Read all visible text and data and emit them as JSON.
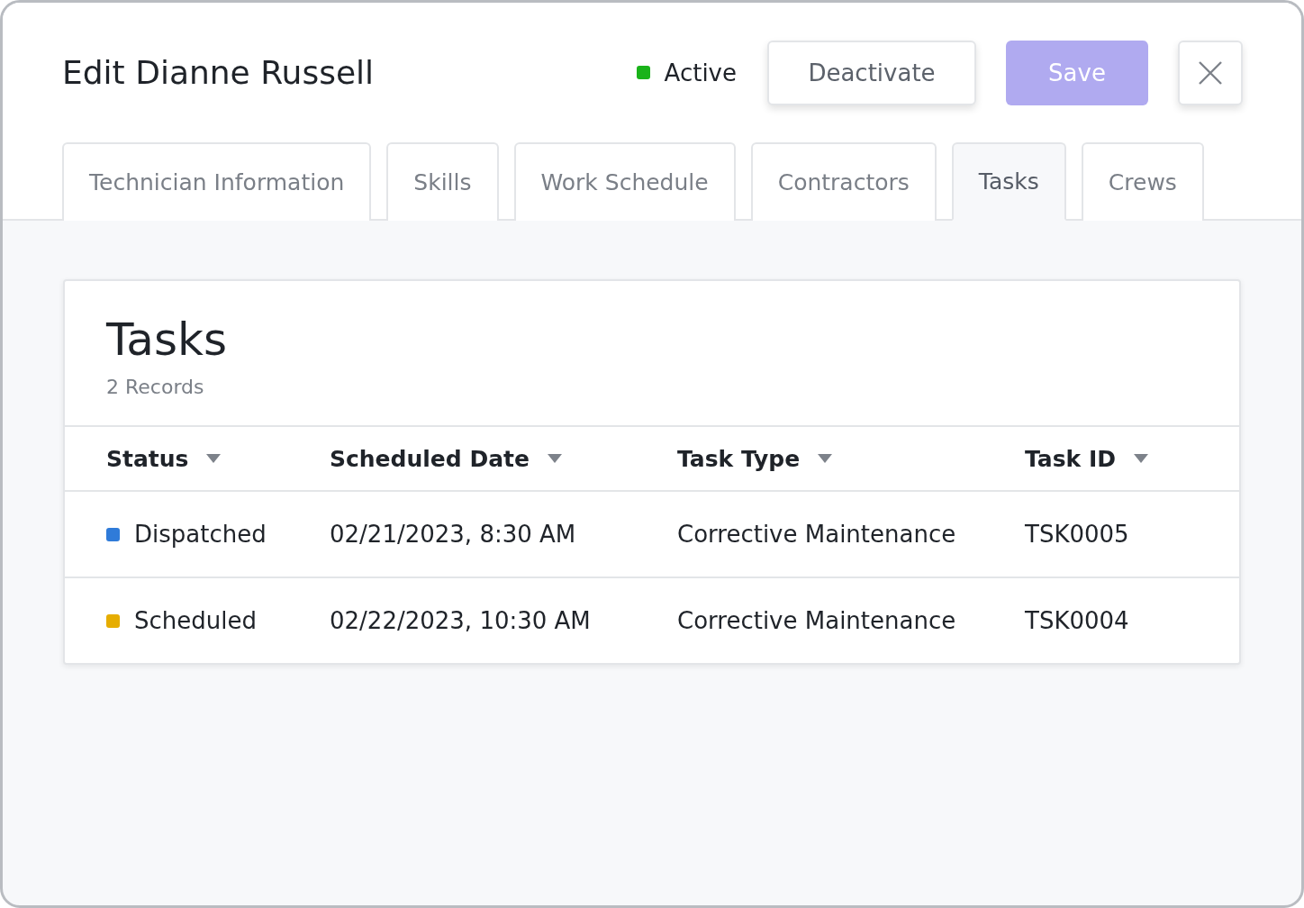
{
  "window": {
    "title": "Edit Dianne Russell"
  },
  "status": {
    "label": "Active",
    "color": "#1ab31a"
  },
  "buttons": {
    "deactivate": "Deactivate",
    "save": "Save"
  },
  "tabs": [
    {
      "label": "Technician Information",
      "selected": false
    },
    {
      "label": "Skills",
      "selected": false
    },
    {
      "label": "Work Schedule",
      "selected": false
    },
    {
      "label": "Contractors",
      "selected": false
    },
    {
      "label": "Tasks",
      "selected": true
    },
    {
      "label": "Crews",
      "selected": false
    }
  ],
  "card": {
    "title": "Tasks",
    "count": "2 Records"
  },
  "table": {
    "columns": [
      "Status",
      "Scheduled Date",
      "Task Type",
      "Task ID"
    ],
    "rows": [
      {
        "status": "Dispatched",
        "color": "#2f7bd9",
        "date": "02/21/2023, 8:30 AM",
        "type": "Corrective Maintenance",
        "id": "TSK0005"
      },
      {
        "status": "Scheduled",
        "color": "#e6ad00",
        "date": "02/22/2023, 10:30 AM",
        "type": "Corrective Maintenance",
        "id": "TSK0004"
      }
    ]
  }
}
